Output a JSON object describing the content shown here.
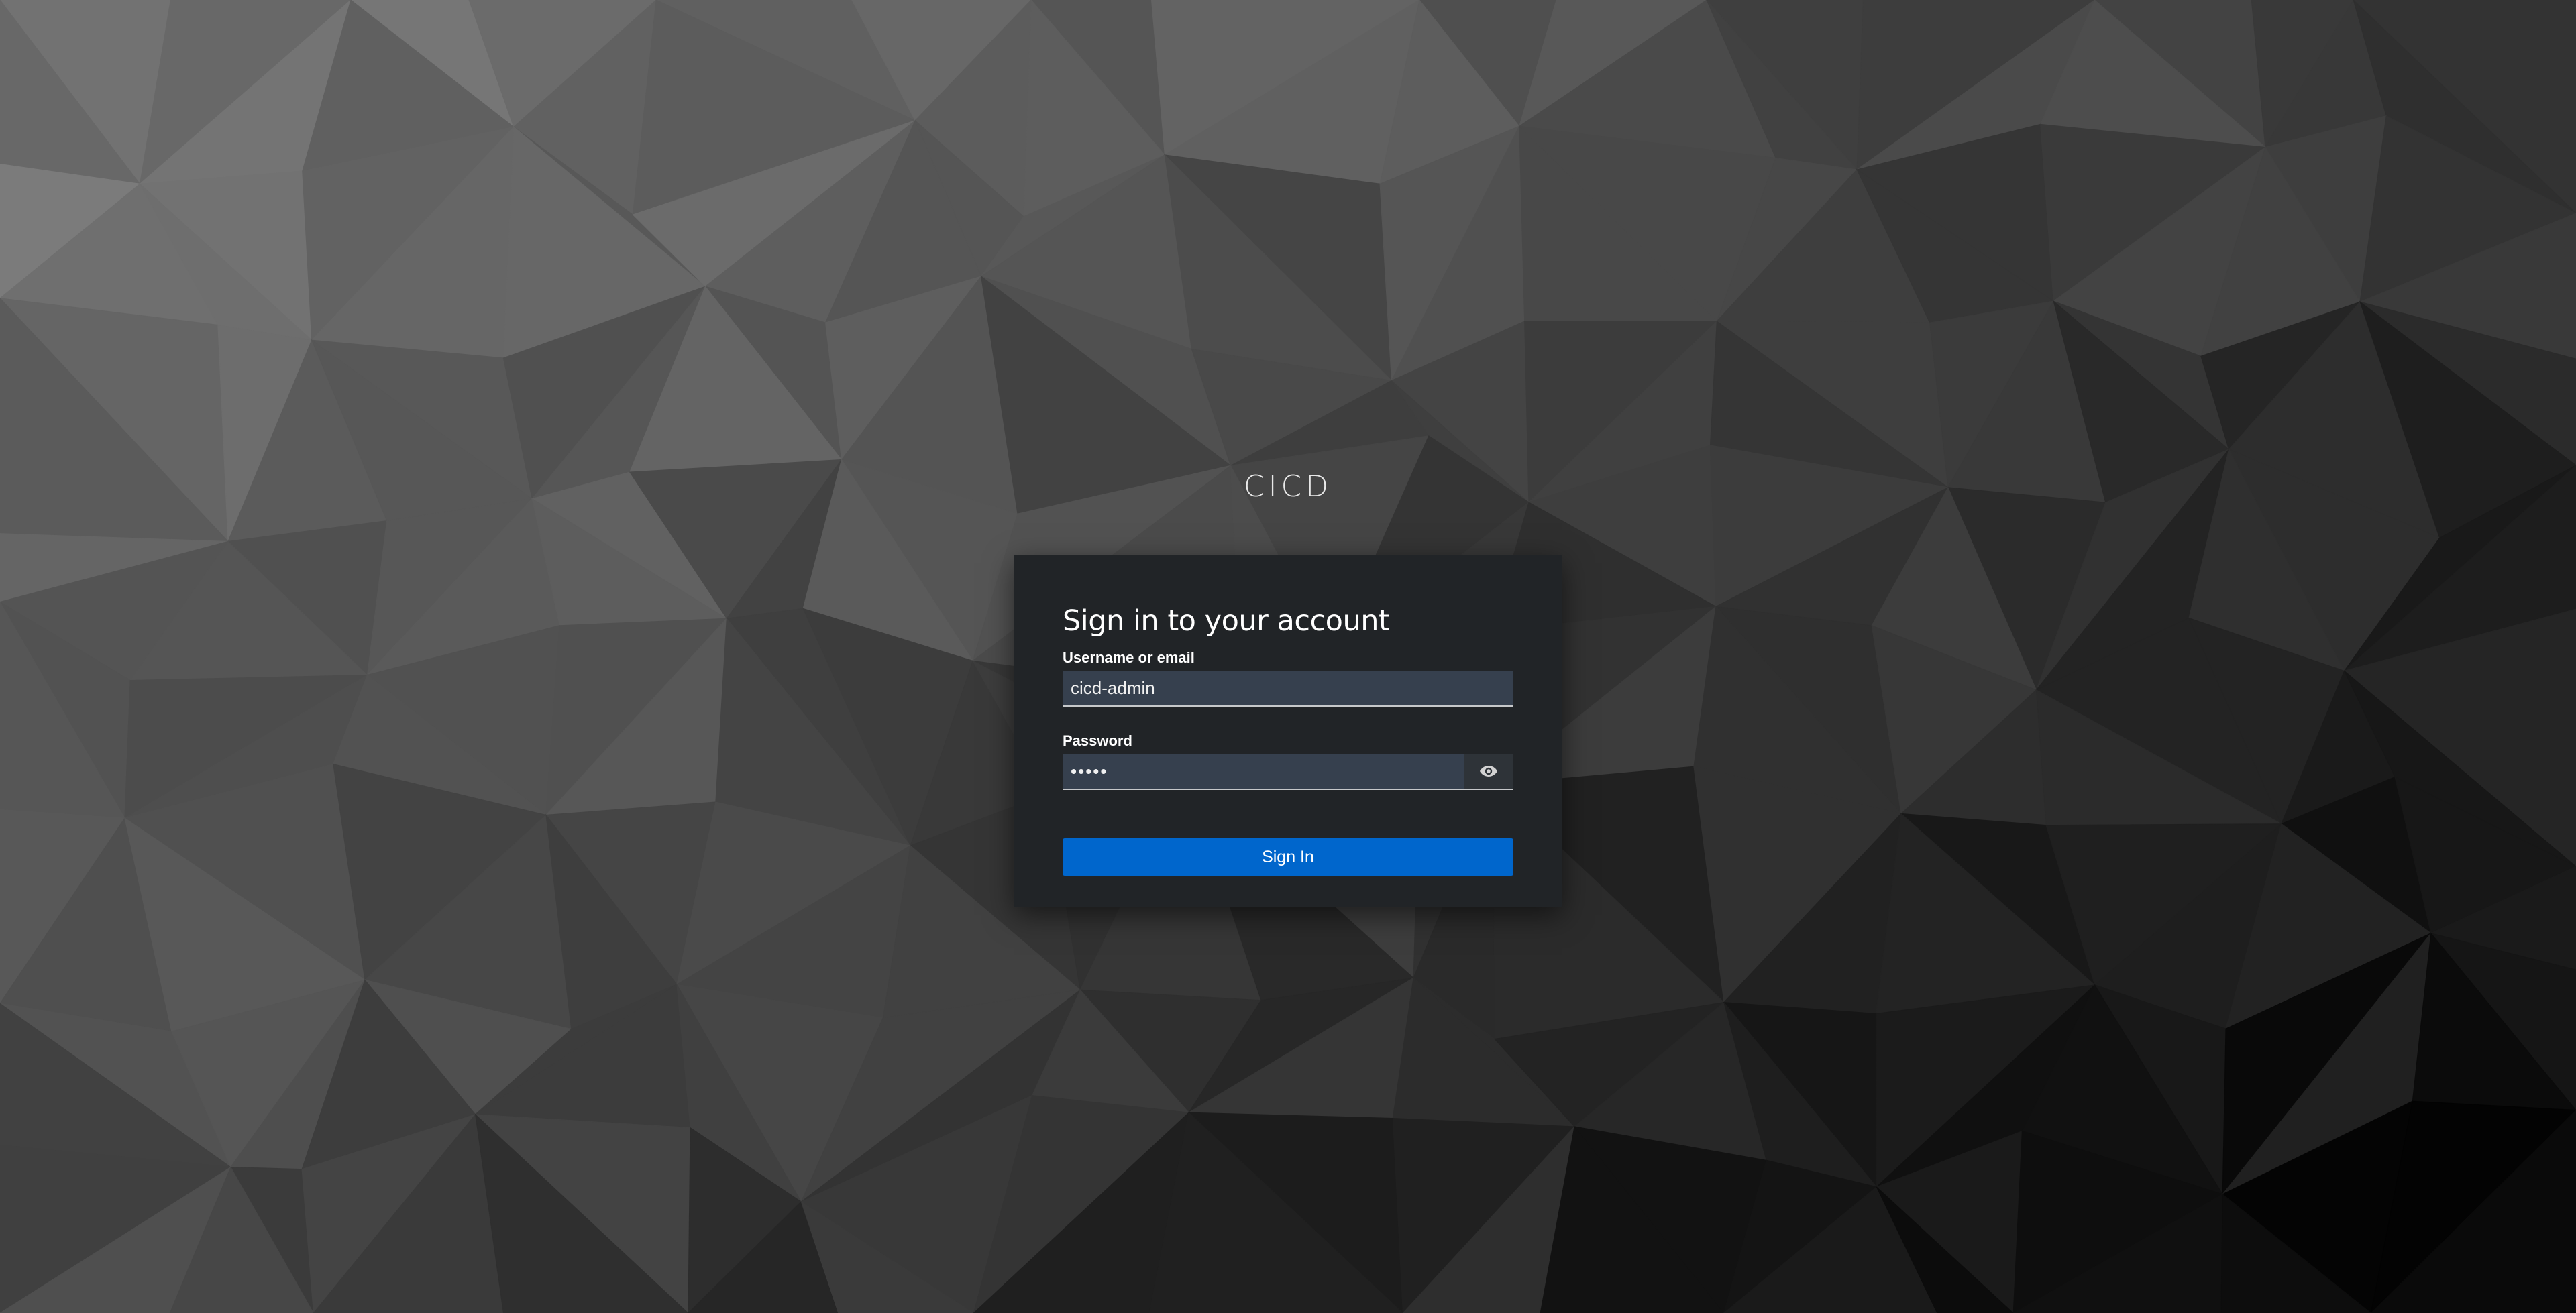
{
  "realm": {
    "title": "CICD"
  },
  "login": {
    "heading": "Sign in to your account",
    "username_label": "Username or email",
    "username_value": "cicd-admin",
    "password_label": "Password",
    "password_value": "•••••",
    "show_password_icon": "eye-icon",
    "submit_label": "Sign In"
  },
  "colors": {
    "card_background": "#212427",
    "input_background": "#36404e",
    "primary_button": "#0066cc"
  }
}
